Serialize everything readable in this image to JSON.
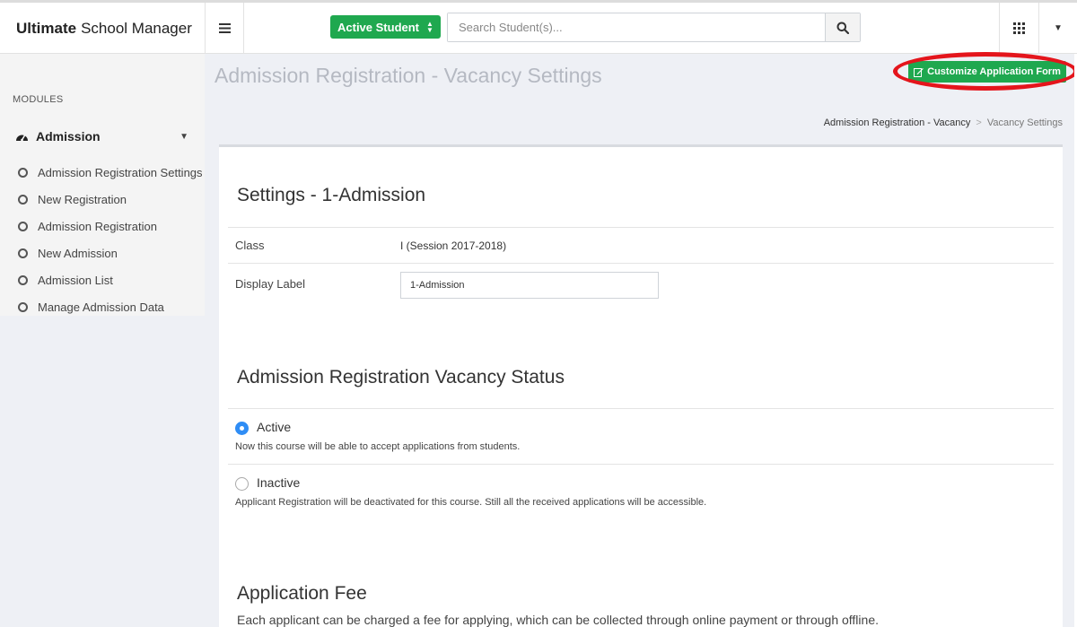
{
  "header": {
    "brand_bold": "Ultimate",
    "brand_rest": "School Manager",
    "status_select": "Active Student",
    "search_placeholder": "Search Student(s)..."
  },
  "sidebar": {
    "section_label": "MODULES",
    "group_label": "Admission",
    "items": [
      {
        "label": "Admission Registration Settings"
      },
      {
        "label": "New Registration"
      },
      {
        "label": "Admission Registration"
      },
      {
        "label": "New Admission"
      },
      {
        "label": "Admission List"
      },
      {
        "label": "Manage Admission Data"
      }
    ]
  },
  "page": {
    "title": "Admission Registration - Vacancy Settings",
    "customize_button": "Customize Application Form",
    "breadcrumb": [
      "Admission Registration - Vacancy",
      "Vacancy Settings"
    ]
  },
  "settings": {
    "title": "Settings - 1-Admission",
    "class_label": "Class",
    "class_value": "I (Session 2017-2018)",
    "display_label_label": "Display Label",
    "display_label_value": "1-Admission"
  },
  "vacancy": {
    "title": "Admission Registration Vacancy Status",
    "options": [
      {
        "label": "Active",
        "desc": "Now this course will be able to accept applications from students.",
        "selected": true
      },
      {
        "label": "Inactive",
        "desc": "Applicant Registration will be deactivated for this course. Still all the received applications will be accessible.",
        "selected": false
      }
    ]
  },
  "fee": {
    "title": "Application Fee",
    "desc": "Each applicant can be charged a fee for applying, which can be collected through online payment or through offline."
  },
  "colors": {
    "accent_green": "#1fa84f",
    "highlight_red": "#e4151c",
    "radio_blue": "#2f8df5"
  },
  "icons": [
    "hamburger-icon",
    "search-icon",
    "grid-icon",
    "caret-down-icon",
    "dashboard-icon",
    "chevron-down-icon",
    "edit-icon",
    "circle-icon"
  ]
}
